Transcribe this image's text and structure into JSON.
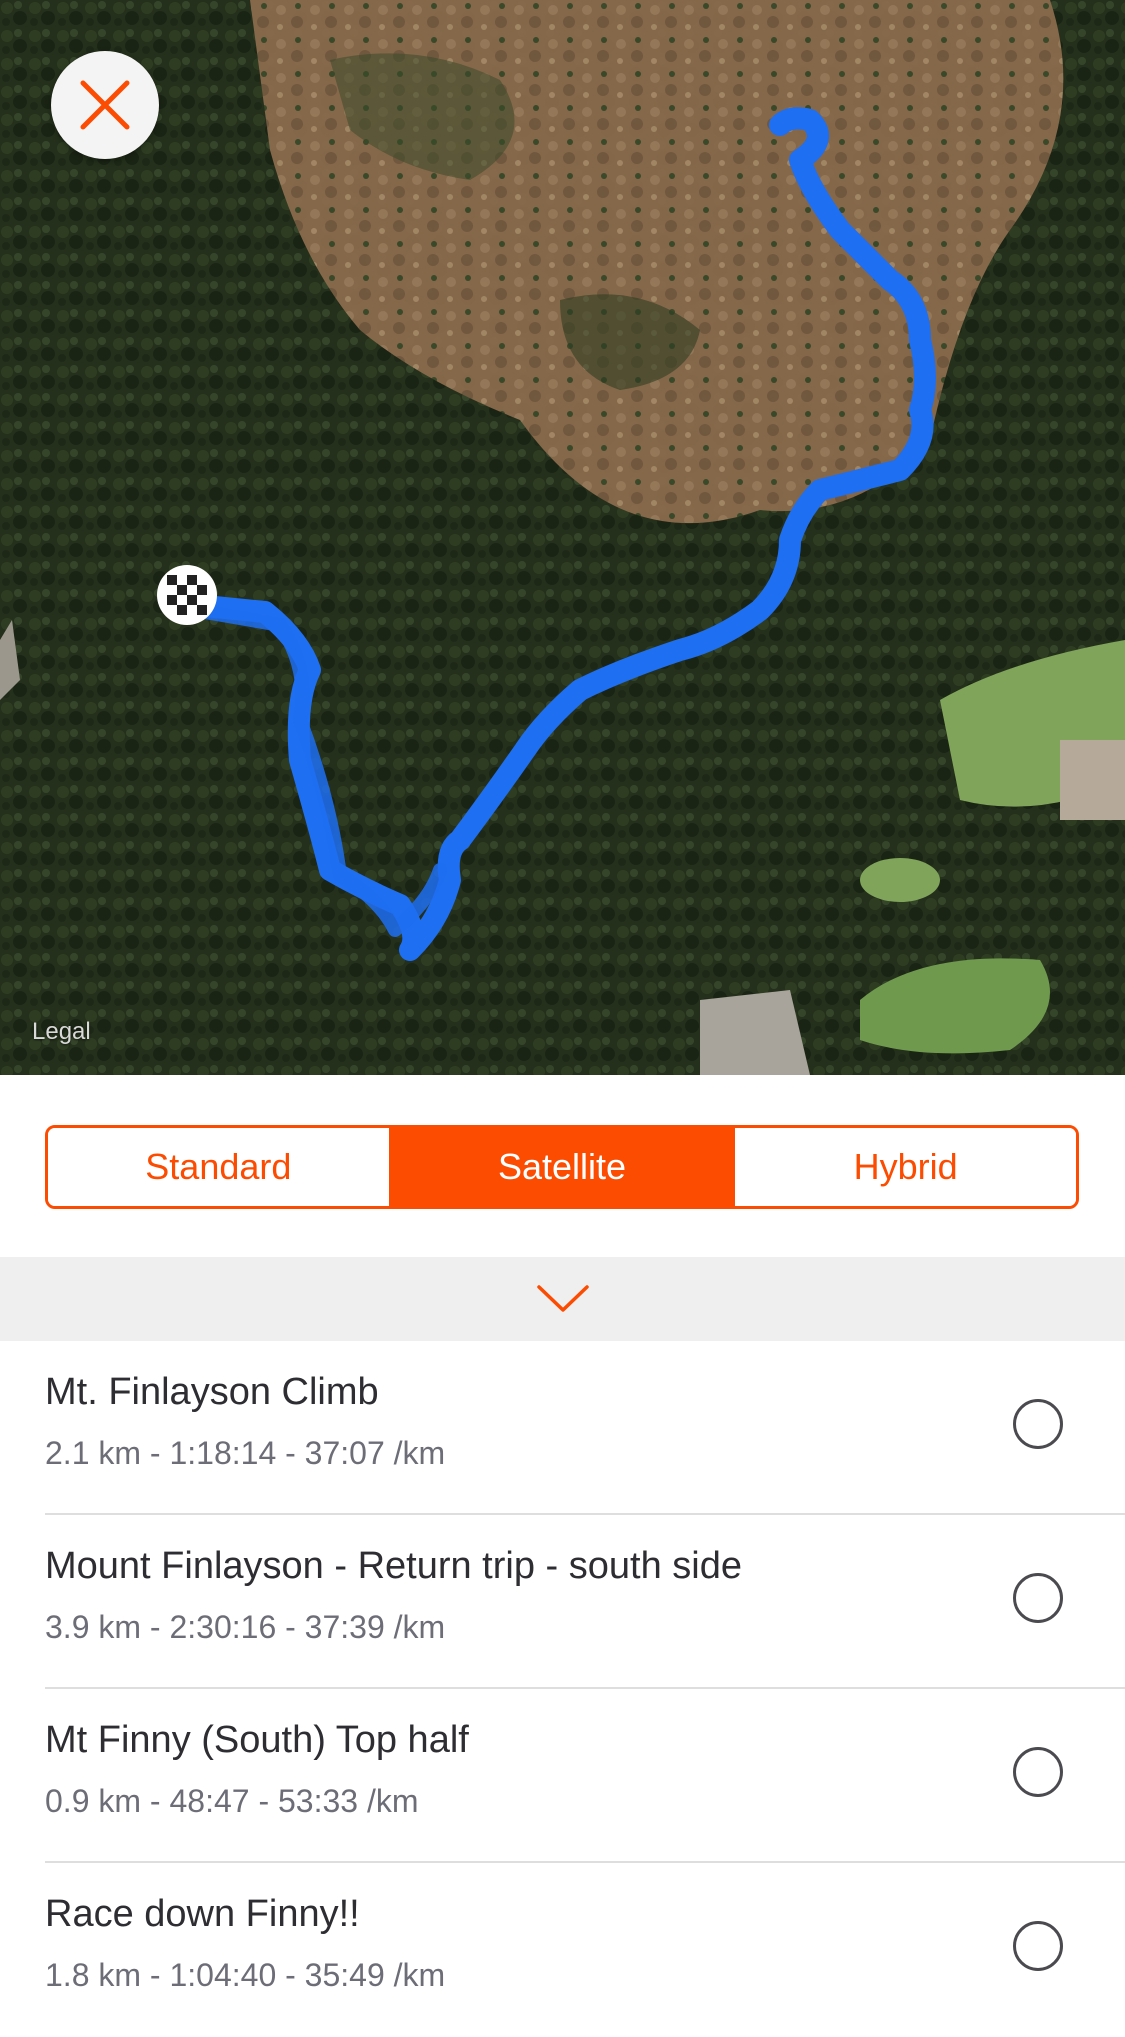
{
  "map": {
    "legal_label": "Legal",
    "route_color": "#1f6ff2",
    "close_icon_color": "#fc4c02",
    "finish_marker": "checkered-flag"
  },
  "map_type": {
    "options": [
      "Standard",
      "Satellite",
      "Hybrid"
    ],
    "selected": "Satellite",
    "accent_color": "#fc4c02"
  },
  "collapse_icon": "chevron-down",
  "segments": [
    {
      "title": "Mt. Finlayson Climb",
      "stats": "2.1 km - 1:18:14 - 37:07 /km"
    },
    {
      "title": "Mount Finlayson - Return trip - south side",
      "stats": "3.9 km - 2:30:16 - 37:39 /km"
    },
    {
      "title": "Mt Finny (South) Top half",
      "stats": "0.9 km - 48:47 - 53:33 /km"
    },
    {
      "title": "Race down Finny!!",
      "stats": "1.8 km - 1:04:40 - 35:49 /km"
    }
  ]
}
